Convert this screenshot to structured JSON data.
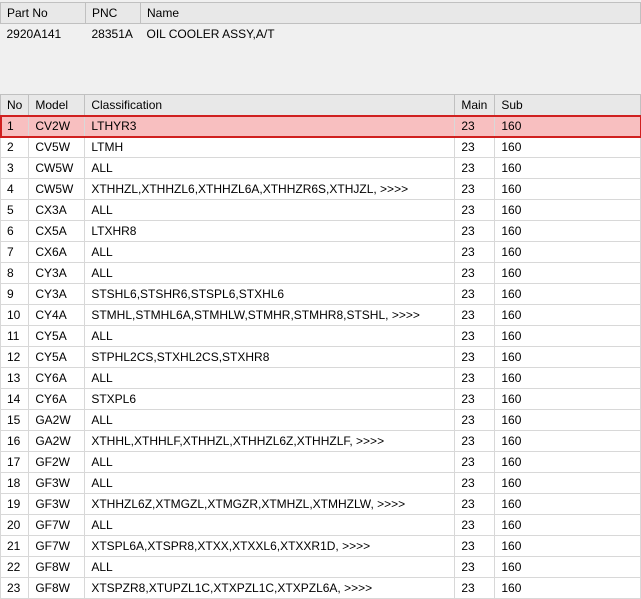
{
  "header": {
    "columns": {
      "partno": "Part No",
      "pnc": "PNC",
      "name": "Name"
    },
    "values": {
      "partno": "2920A141",
      "pnc": "28351A",
      "name": "OIL COOLER ASSY,A/T"
    }
  },
  "table": {
    "columns": {
      "no": "No",
      "model": "Model",
      "classification": "Classification",
      "main": "Main",
      "sub": "Sub"
    },
    "rows": [
      {
        "no": "1",
        "model": "CV2W",
        "classification": "LTHYR3",
        "main": "23",
        "sub": "160",
        "selected": true
      },
      {
        "no": "2",
        "model": "CV5W",
        "classification": "LTMH",
        "main": "23",
        "sub": "160"
      },
      {
        "no": "3",
        "model": "CW5W",
        "classification": "ALL",
        "main": "23",
        "sub": "160"
      },
      {
        "no": "4",
        "model": "CW5W",
        "classification": "XTHHZL,XTHHZL6,XTHHZL6A,XTHHZR6S,XTHJZL,  >>>>",
        "main": "23",
        "sub": "160"
      },
      {
        "no": "5",
        "model": "CX3A",
        "classification": "ALL",
        "main": "23",
        "sub": "160"
      },
      {
        "no": "6",
        "model": "CX5A",
        "classification": "LTXHR8",
        "main": "23",
        "sub": "160"
      },
      {
        "no": "7",
        "model": "CX6A",
        "classification": "ALL",
        "main": "23",
        "sub": "160"
      },
      {
        "no": "8",
        "model": "CY3A",
        "classification": "ALL",
        "main": "23",
        "sub": "160"
      },
      {
        "no": "9",
        "model": "CY3A",
        "classification": "STSHL6,STSHR6,STSPL6,STXHL6",
        "main": "23",
        "sub": "160"
      },
      {
        "no": "10",
        "model": "CY4A",
        "classification": "STMHL,STMHL6A,STMHLW,STMHR,STMHR8,STSHL,  >>>>",
        "main": "23",
        "sub": "160"
      },
      {
        "no": "11",
        "model": "CY5A",
        "classification": "ALL",
        "main": "23",
        "sub": "160"
      },
      {
        "no": "12",
        "model": "CY5A",
        "classification": "STPHL2CS,STXHL2CS,STXHR8",
        "main": "23",
        "sub": "160"
      },
      {
        "no": "13",
        "model": "CY6A",
        "classification": "ALL",
        "main": "23",
        "sub": "160"
      },
      {
        "no": "14",
        "model": "CY6A",
        "classification": "STXPL6",
        "main": "23",
        "sub": "160"
      },
      {
        "no": "15",
        "model": "GA2W",
        "classification": "ALL",
        "main": "23",
        "sub": "160"
      },
      {
        "no": "16",
        "model": "GA2W",
        "classification": "XTHHL,XTHHLF,XTHHZL,XTHHZL6Z,XTHHZLF,  >>>>",
        "main": "23",
        "sub": "160"
      },
      {
        "no": "17",
        "model": "GF2W",
        "classification": "ALL",
        "main": "23",
        "sub": "160"
      },
      {
        "no": "18",
        "model": "GF3W",
        "classification": "ALL",
        "main": "23",
        "sub": "160"
      },
      {
        "no": "19",
        "model": "GF3W",
        "classification": "XTHHZL6Z,XTMGZL,XTMGZR,XTMHZL,XTMHZLW,  >>>>",
        "main": "23",
        "sub": "160"
      },
      {
        "no": "20",
        "model": "GF7W",
        "classification": "ALL",
        "main": "23",
        "sub": "160"
      },
      {
        "no": "21",
        "model": "GF7W",
        "classification": "XTSPL6A,XTSPR8,XTXX,XTXXL6,XTXXR1D,  >>>>",
        "main": "23",
        "sub": "160"
      },
      {
        "no": "22",
        "model": "GF8W",
        "classification": "ALL",
        "main": "23",
        "sub": "160"
      },
      {
        "no": "23",
        "model": "GF8W",
        "classification": "XTSPZR8,XTUPZL1C,XTXPZL1C,XTXPZL6A,  >>>>",
        "main": "23",
        "sub": "160"
      }
    ]
  }
}
